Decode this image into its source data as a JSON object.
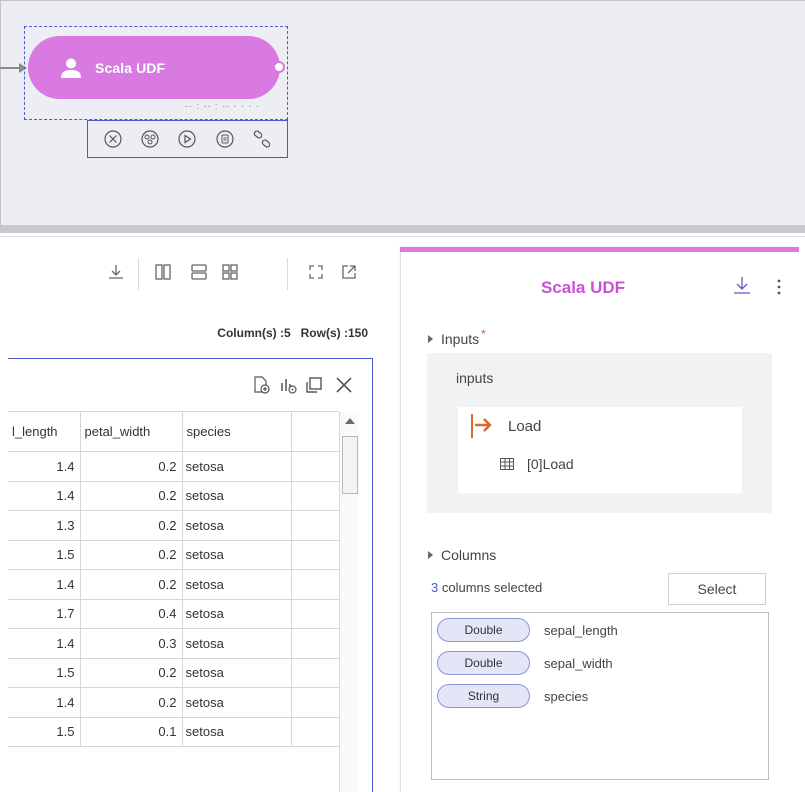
{
  "node": {
    "title": "Scala UDF",
    "sub_label": "-- : -- : -- - - - -",
    "accent_color": "#d97ae3",
    "tools": [
      "close-circle-icon",
      "link-nodes-icon",
      "play-icon",
      "clipboard-icon",
      "link-icon"
    ]
  },
  "preview": {
    "toolbar_icons": [
      "download-icon",
      "columns-layout-icon",
      "rows-layout-icon",
      "grid-layout-icon",
      "expand-icon",
      "open-external-icon"
    ],
    "column_count_label": "Column(s) :5",
    "row_count_label": "Row(s) :150",
    "grid_tools": [
      "add-file-icon",
      "chart-settings-icon",
      "copy-window-icon",
      "close-icon"
    ],
    "columns": [
      "l_length",
      "petal_width",
      "species"
    ],
    "rows": [
      [
        "1.4",
        "0.2",
        "setosa"
      ],
      [
        "1.4",
        "0.2",
        "setosa"
      ],
      [
        "1.3",
        "0.2",
        "setosa"
      ],
      [
        "1.5",
        "0.2",
        "setosa"
      ],
      [
        "1.4",
        "0.2",
        "setosa"
      ],
      [
        "1.7",
        "0.4",
        "setosa"
      ],
      [
        "1.4",
        "0.3",
        "setosa"
      ],
      [
        "1.5",
        "0.2",
        "setosa"
      ],
      [
        "1.4",
        "0.2",
        "setosa"
      ],
      [
        "1.5",
        "0.1",
        "setosa"
      ]
    ]
  },
  "panel": {
    "title": "Scala UDF",
    "inputs_section": "Inputs",
    "required_mark": "*",
    "inputs_label": "inputs",
    "load_label": "Load",
    "load_sub": "[0]Load",
    "columns_section": "Columns",
    "selected_count": "3",
    "selected_text": " columns selected",
    "select_button": "Select",
    "columns": [
      {
        "type": "Double",
        "name": "sepal_length"
      },
      {
        "type": "Double",
        "name": "sepal_width"
      },
      {
        "type": "String",
        "name": "species"
      }
    ]
  }
}
